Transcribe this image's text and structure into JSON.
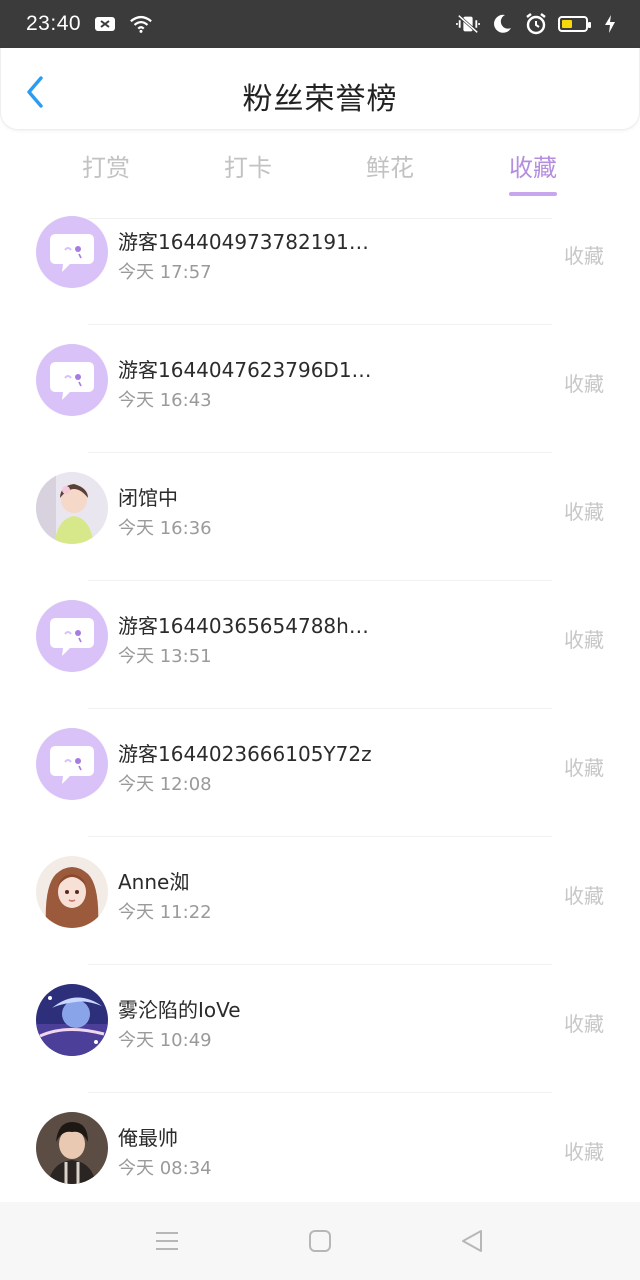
{
  "statusbar": {
    "time": "23:40"
  },
  "header": {
    "title": "粉丝荣誉榜"
  },
  "tabs": [
    {
      "label": "打赏",
      "active": false
    },
    {
      "label": "打卡",
      "active": false
    },
    {
      "label": "鲜花",
      "active": false
    },
    {
      "label": "收藏",
      "active": true
    }
  ],
  "list": [
    {
      "name": "游客164404973782191…",
      "time": "今天 17:57",
      "action": "收藏",
      "avatar": "default-chat-icon"
    },
    {
      "name": "游客1644047623796D1…",
      "time": "今天 16:43",
      "action": "收藏",
      "avatar": "default-chat-icon"
    },
    {
      "name": "闭馆中",
      "time": "今天 16:36",
      "action": "收藏",
      "avatar": "photo-girl"
    },
    {
      "name": "游客16440365654788h…",
      "time": "今天 13:51",
      "action": "收藏",
      "avatar": "default-chat-icon"
    },
    {
      "name": "游客1644023666105Y72z",
      "time": "今天 12:08",
      "action": "收藏",
      "avatar": "default-chat-icon"
    },
    {
      "name": "Anne洳",
      "time": "今天 11:22",
      "action": "收藏",
      "avatar": "photo-anime-girl"
    },
    {
      "name": "雾沦陷的IoVe",
      "time": "今天 10:49",
      "action": "收藏",
      "avatar": "photo-night"
    },
    {
      "name": "俺最帅",
      "time": "今天 08:34",
      "action": "收藏",
      "avatar": "photo-boy"
    }
  ],
  "colors": {
    "accent": "#b48fe0",
    "avatar_default": "#d8c2f7",
    "back": "#2b9cf0"
  }
}
